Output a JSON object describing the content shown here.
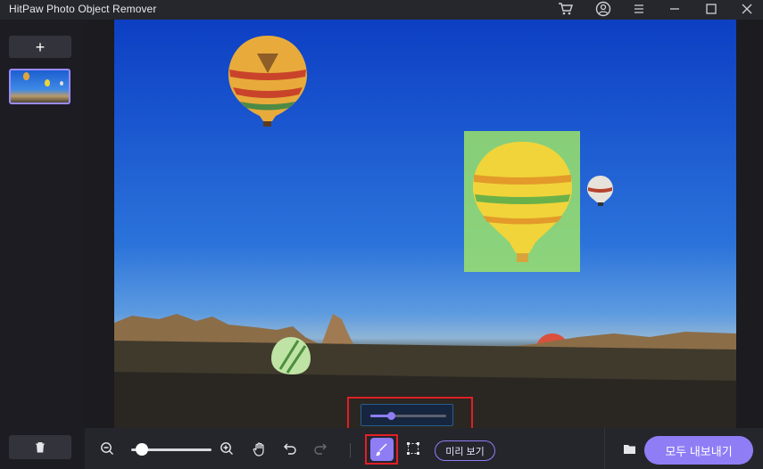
{
  "app": {
    "title": "HitPaw Photo Object Remover"
  },
  "titlebar_icons": [
    "cart-icon",
    "account-icon",
    "menu-icon",
    "minimize-icon",
    "maximize-icon",
    "close-icon"
  ],
  "sidebar": {
    "add_label": "+",
    "thumbnail_alt": "hot air balloons photo",
    "trash_icon": "trash-icon"
  },
  "toolbar": {
    "zoom_level": 0.06,
    "brush_size": 0.28,
    "preview_label": "미리 보기",
    "export_label": "모두 내보내기",
    "icons": [
      "zoom-out-icon",
      "zoom-in-icon",
      "hand-icon",
      "undo-icon",
      "redo-icon",
      "brush-icon",
      "rect-select-icon",
      "folder-icon"
    ]
  },
  "colors": {
    "accent": "#8f7df5",
    "highlight": "#e21f26",
    "selection_overlay": "#9be36a"
  }
}
